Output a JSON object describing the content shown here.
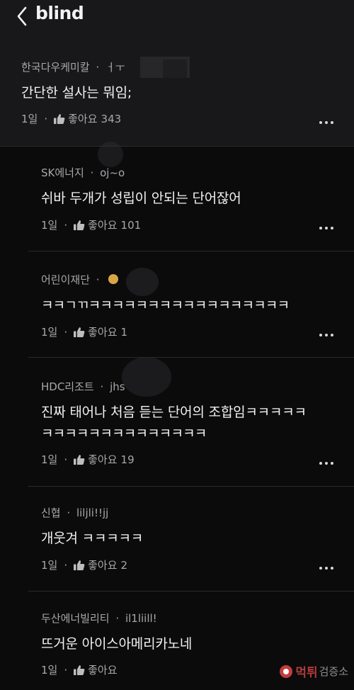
{
  "header": {
    "logo": "blind"
  },
  "main_post": {
    "company": "한국다우케미칼",
    "nick": "ㅓㅜ",
    "content": "간단한 설사는 뭐임;",
    "age": "1일",
    "like_label": "좋아요",
    "like_count": "343"
  },
  "comments": [
    {
      "company": "SK에너지",
      "nick": "oj~o",
      "content": "쉬바 두개가 성립이 안되는 단어잖어",
      "age": "1일",
      "like_label": "좋아요",
      "like_count": "101"
    },
    {
      "company": "어린이재단",
      "nick": "",
      "content": "ㅋㅋㄱㄲㅋㅋㅋㅋㅋㅋㅋㅋㅋㅋㅋㅋㅋㅋㅋㅋㅋ",
      "age": "1일",
      "like_label": "좋아요",
      "like_count": "1"
    },
    {
      "company": "HDC리조트",
      "nick": "jhs",
      "content": "진짜 태어나 처음 듣는 단어의 조합임ㅋㅋㅋㅋㅋ",
      "content2": "ㅋㅋㅋㅋㅋㅋㅋㅋㅋㅋㅋㅋㅋㅋ",
      "age": "1일",
      "like_label": "좋아요",
      "like_count": "19"
    },
    {
      "company": "신협",
      "nick": "liljli!!jj",
      "content": "개웃겨 ㅋㅋㅋㅋㅋ",
      "age": "1일",
      "like_label": "좋아요",
      "like_count": "2"
    },
    {
      "company": "두산에너빌리티",
      "nick": "il1liill!",
      "content": "뜨거운 아이스아메리카노네",
      "age": "1일",
      "like_label": "좋아요",
      "like_count": ""
    }
  ],
  "separator": "·",
  "watermark": {
    "brand": "먹튀",
    "sub": "검증소"
  },
  "colors": {
    "background": "#0b0b0c",
    "header_bg": "#18181a",
    "text_primary": "#f1f1f1",
    "text_secondary": "#a8a8ab",
    "watermark": "#c43c3c"
  },
  "icons": [
    "back-chevron-icon",
    "thumbs-up-icon",
    "more-dots-icon"
  ]
}
